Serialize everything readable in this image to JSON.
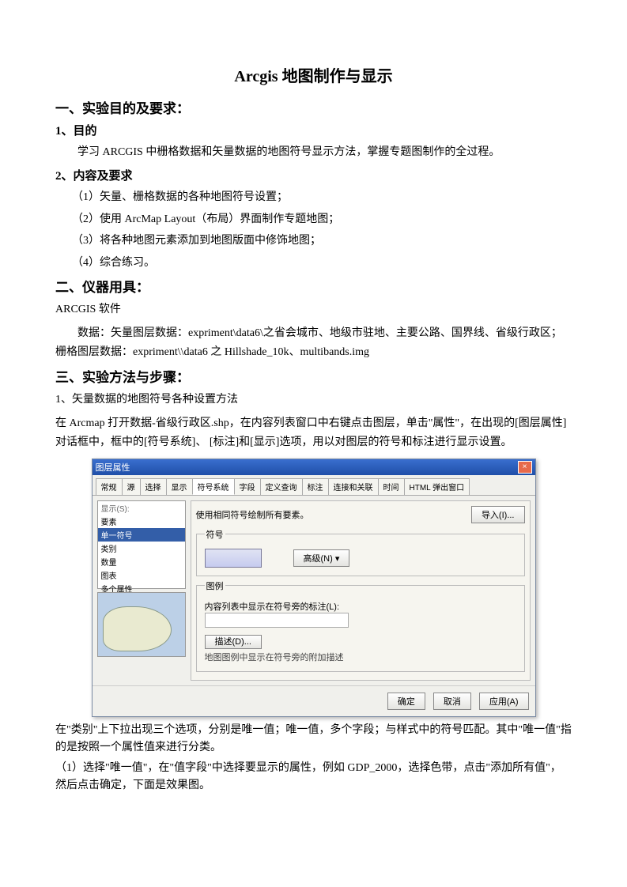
{
  "title": "Arcgis 地图制作与显示",
  "sec1": {
    "heading": "一、实验目的及要求：",
    "sub1": "1、目的",
    "p1": "学习 ARCGIS 中栅格数据和矢量数据的地图符号显示方法，掌握专题图制作的全过程。",
    "sub2": "2、内容及要求",
    "items": [
      "（1）矢量、栅格数据的各种地图符号设置；",
      "（2）使用 ArcMap Layout（布局）界面制作专题地图；",
      "（3）将各种地图元素添加到地图版面中修饰地图；",
      "（4）综合练习。"
    ]
  },
  "sec2": {
    "heading": "二、仪器用具：",
    "p1": "ARCGIS 软件",
    "p2": "数据：矢量图层数据：expriment\\data6\\之省会城市、地级市驻地、主要公路、国界线、省级行政区；栅格图层数据：expriment\\\\data6 之 Hillshade_10k、multibands.img"
  },
  "sec3": {
    "heading": "三、实验方法与步骤：",
    "p1": "1、矢量数据的地图符号各种设置方法",
    "p2": "在 Arcmap 打开数据-省级行政区.shp，在内容列表窗口中右键点击图层，单击\"属性\"，在出现的[图层属性]对话框中，框中的[符号系统]、 [标注]和[显示]选项，用以对图层的符号和标注进行显示设置。"
  },
  "dialog": {
    "title": "图层属性",
    "tabs": [
      "常规",
      "源",
      "选择",
      "显示",
      "符号系统",
      "字段",
      "定义查询",
      "标注",
      "连接和关联",
      "时间",
      "HTML 弹出窗口"
    ],
    "active_tab": 4,
    "list_header": "显示(S):",
    "list_items": [
      "要素",
      "单一符号",
      "类别",
      "数量",
      "图表",
      "多个属性"
    ],
    "list_selected": 1,
    "right_title": "使用相同符号绘制所有要素。",
    "import_btn": "导入(I)...",
    "fieldset1": "符号",
    "advanced_btn": "高级(N)  ▾",
    "fieldset2": "图例",
    "legend_label": "内容列表中显示在符号旁的标注(L):",
    "desc_btn": "描述(D)...",
    "desc_text": "地图图例中显示在符号旁的附加描述",
    "footer": {
      "ok": "确定",
      "cancel": "取消",
      "apply": "应用(A)"
    }
  },
  "after": {
    "p1": "在\"类别\"上下拉出现三个选项，分别是唯一值；唯一值，多个字段；与样式中的符号匹配。其中\"唯一值\"指的是按照一个属性值来进行分类。",
    "p2": "（1）选择\"唯一值\"，在\"值字段\"中选择要显示的属性，例如 GDP_2000，选择色带，点击\"添加所有值\"，然后点击确定，下面是效果图。"
  }
}
